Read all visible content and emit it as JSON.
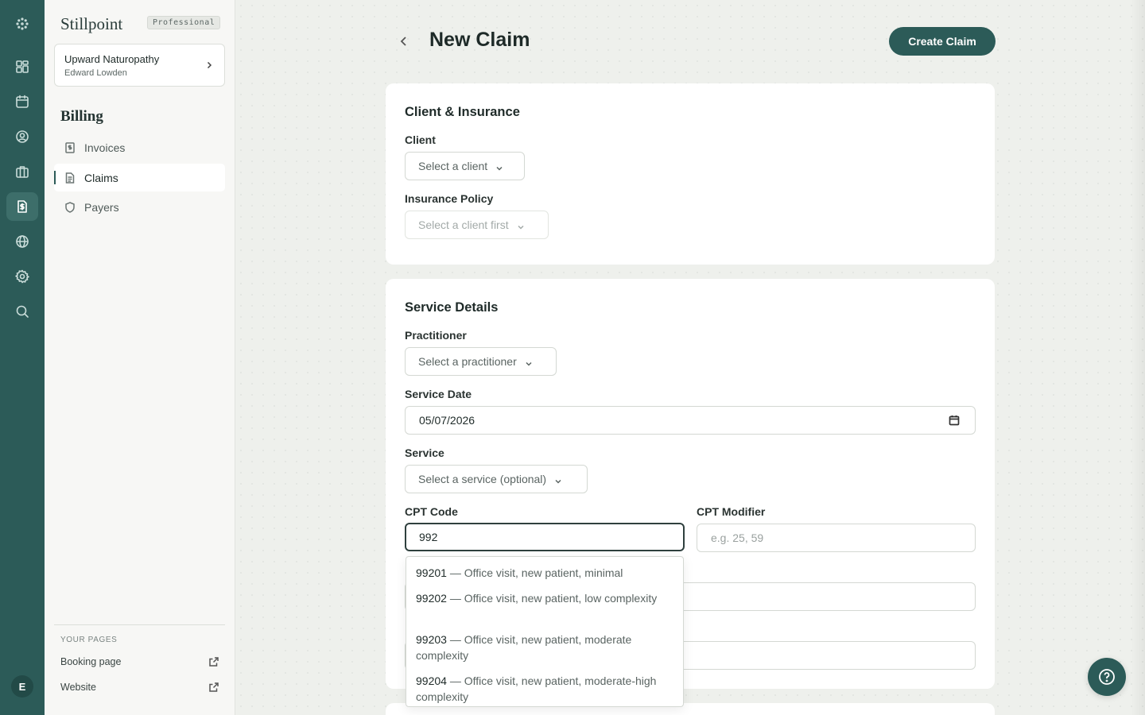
{
  "colors": {
    "accent": "#2c5b58",
    "rail": "#2c5b58",
    "sidebar_bg": "#f7f7f5",
    "main_bg": "#eef0ec"
  },
  "rail": {
    "icons": [
      "logo-icon",
      "dashboard-icon",
      "calendar-icon",
      "clients-icon",
      "briefcase-icon",
      "billing-icon",
      "globe-icon",
      "settings-icon",
      "search-icon"
    ],
    "active": "billing-icon",
    "avatar_initial": "E"
  },
  "sidebar": {
    "brand": "Stillpoint",
    "plan_badge": "Professional",
    "org": {
      "name": "Upward Naturopathy",
      "user": "Edward Lowden"
    },
    "section_title": "Billing",
    "items": [
      {
        "label": "Invoices",
        "icon": "invoice-icon",
        "active": false
      },
      {
        "label": "Claims",
        "icon": "document-icon",
        "active": true
      },
      {
        "label": "Payers",
        "icon": "shield-icon",
        "active": false
      }
    ],
    "pages_heading": "YOUR PAGES",
    "pages": [
      {
        "label": "Booking page",
        "icon": "external-link-icon"
      },
      {
        "label": "Website",
        "icon": "external-link-icon"
      }
    ]
  },
  "header": {
    "title": "New Claim",
    "create_button": "Create Claim"
  },
  "client_card": {
    "title": "Client & Insurance",
    "client_label": "Client",
    "client_placeholder": "Select a client",
    "policy_label": "Insurance Policy",
    "policy_placeholder": "Select a client first"
  },
  "service_card": {
    "title": "Service Details",
    "practitioner_label": "Practitioner",
    "practitioner_placeholder": "Select a practitioner",
    "service_date_label": "Service Date",
    "service_date_value": "05/07/2026",
    "service_label": "Service",
    "service_placeholder": "Select a service (optional)",
    "cpt_label": "CPT Code",
    "cpt_value": "992",
    "modifier_label": "CPT Modifier",
    "modifier_placeholder": "e.g. 25, 59"
  },
  "cpt_suggestions": [
    {
      "code": "99201",
      "desc": " — Office visit, new patient, minimal"
    },
    {
      "code": "99202",
      "desc": " — Office visit, new patient, low complexity"
    },
    {
      "code": "99203",
      "desc": " — Office visit, new patient, moderate complexity"
    },
    {
      "code": "99204",
      "desc": " — Office visit, new patient, moderate-high complexity"
    }
  ]
}
